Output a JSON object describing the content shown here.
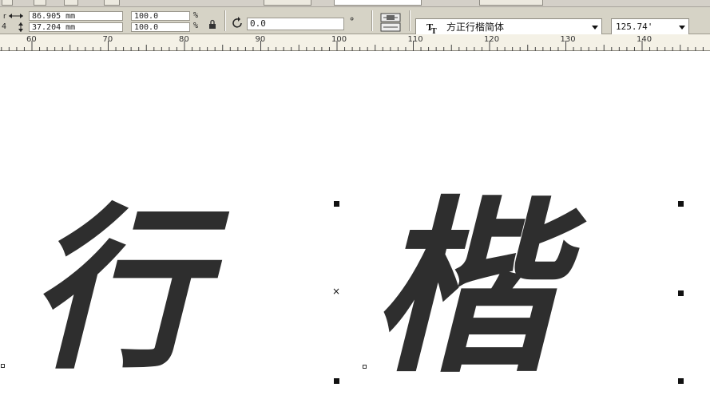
{
  "property_bar": {
    "width_label": "86.905 mm",
    "height_label": "37.204 mm",
    "scale_x": "100.0",
    "scale_y": "100.0",
    "percent": "%",
    "rotation": "0.0",
    "degree": "°",
    "font_name": "方正行楷简体",
    "font_size": "125.74'",
    "left_digit": "4"
  },
  "ruler": {
    "labels": [
      "60",
      "70",
      "80",
      "90",
      "100",
      "110",
      "120",
      "130",
      "140"
    ]
  },
  "canvas": {
    "char_1": "行",
    "char_2": "楷"
  },
  "icons": {
    "width": "horizontal-arrows-icon",
    "height": "vertical-arrows-icon",
    "lock": "lock-icon",
    "rotate": "rotate-icon",
    "font_type": "truetype-font-icon"
  }
}
